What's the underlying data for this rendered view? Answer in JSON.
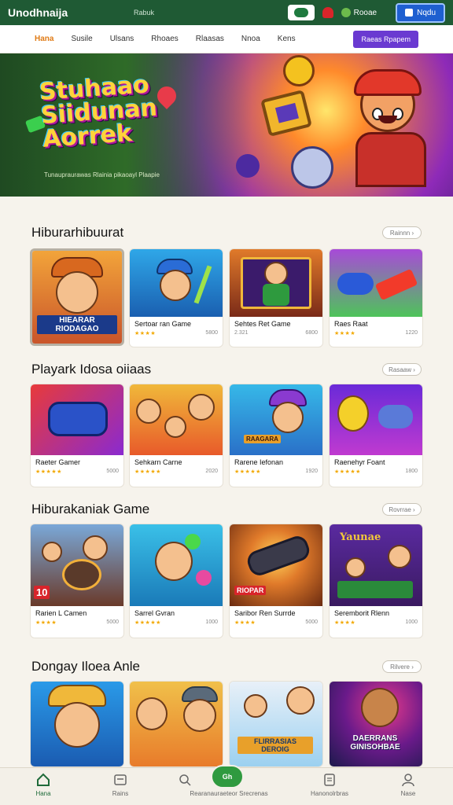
{
  "topbar": {
    "brand": "Unodhnaija",
    "search_text": "Rabuk",
    "coin_text": "Rooae",
    "login_label": "Nqdu"
  },
  "nav": {
    "items": [
      "Hana",
      "Susile",
      "Ulsans",
      "Rhoaes",
      "Rlaasas",
      "Nnoa",
      "Kens"
    ],
    "active_index": 0,
    "cta_label": "Raeas Rpapem"
  },
  "hero": {
    "title": "Stuhaao Siidunan Aorrek",
    "subtitle": "Tunaupraurawas Rlainia pikaoayl Plaapie"
  },
  "sections": [
    {
      "title": "Hiburarhibuurat",
      "more_label": "Rainnn",
      "cards": [
        {
          "title": "",
          "rating": "",
          "meta": "",
          "art_label": "HIEARAR RIODAGAO"
        },
        {
          "title": "Sertoar ran Game",
          "rating": "★★★★",
          "meta": "5800",
          "art_label": ""
        },
        {
          "title": "Sehtes Ret Game",
          "rating": "2.321",
          "meta": "6800",
          "art_label": ""
        },
        {
          "title": "Raes Raat",
          "rating": "★★★★",
          "meta": "1220",
          "art_label": ""
        }
      ]
    },
    {
      "title": "Playark Idosa oiiaas",
      "more_label": "Rasaaw",
      "cards": [
        {
          "title": "Raeter Gamer",
          "rating": "★★★★★",
          "meta": "5000",
          "art_label": ""
        },
        {
          "title": "Sehkarn Carne",
          "rating": "★★★★★",
          "meta": "2020",
          "art_label": ""
        },
        {
          "title": "Rarene Iefonan",
          "rating": "★★★★★",
          "meta": "1920",
          "art_label": "RAAGARA"
        },
        {
          "title": "Raenehyr Foant",
          "rating": "★★★★★",
          "meta": "1800",
          "art_label": ""
        }
      ]
    },
    {
      "title": "Hiburakaniak Game",
      "more_label": "Rovrrae",
      "cards": [
        {
          "title": "Rarien L Camen",
          "rating": "★★★★",
          "meta": "5000",
          "art_label": "10"
        },
        {
          "title": "Sarrel Gvran",
          "rating": "★★★★★",
          "meta": "1000",
          "art_label": ""
        },
        {
          "title": "Saribor Ren Surrde",
          "rating": "★★★★",
          "meta": "5000",
          "art_label": "RIOPAR"
        },
        {
          "title": "Seremborit Rlenn",
          "rating": "★★★★",
          "meta": "1000",
          "art_label": "Yaunae"
        }
      ]
    },
    {
      "title": "Dongay Iloea Anle",
      "more_label": "Rilvere",
      "cards": [
        {
          "title": "",
          "rating": "",
          "meta": "",
          "art_label": ""
        },
        {
          "title": "",
          "rating": "",
          "meta": "",
          "art_label": ""
        },
        {
          "title": "",
          "rating": "",
          "meta": "",
          "art_label": "FLIRRASIAS DEROIG"
        },
        {
          "title": "",
          "rating": "",
          "meta": "",
          "art_label": "DAERRANS GINISOHBAE"
        }
      ]
    }
  ],
  "bottomnav": {
    "items": [
      "Hana",
      "Rains",
      "Rearanauraeteor Srecrenas",
      "Hanonolrbras",
      "Nase"
    ],
    "center_label": "Gh",
    "active_index": 0
  },
  "colors": {
    "brand_green": "#1f5a34",
    "accent_orange": "#e07b16",
    "cta_purple": "#6a3ad1",
    "login_blue": "#1e5fd0"
  }
}
